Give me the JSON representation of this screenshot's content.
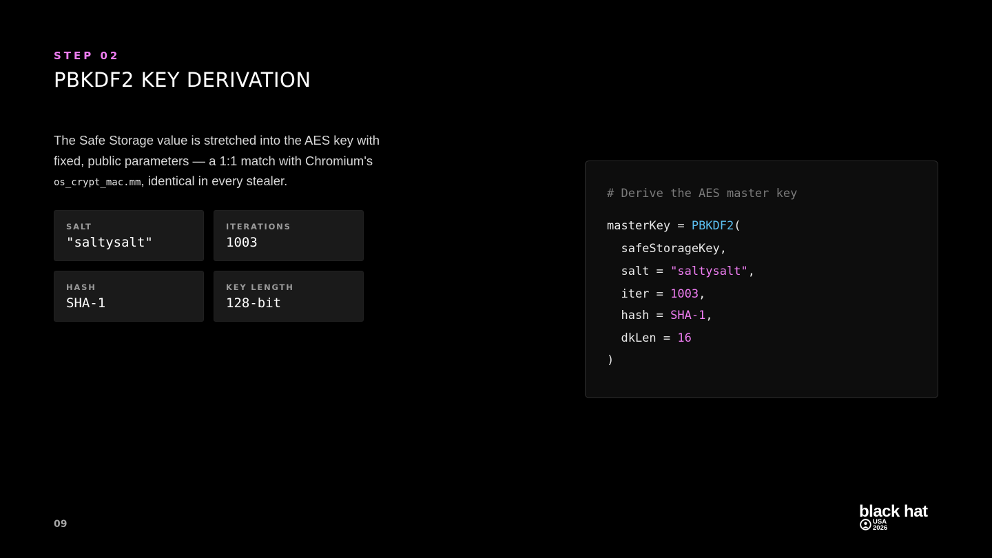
{
  "slide": {
    "eyebrow": "STEP 02",
    "title": "PBKDF2 KEY DERIVATION",
    "description": {
      "part1": "The Safe Storage value is stretched into the AES key with fixed, public parameters — a 1:1 match with Chromium's ",
      "code": "os_crypt_mac.mm",
      "part2": ", identical in every stealer."
    },
    "page_number": "09"
  },
  "params": [
    {
      "label": "SALT",
      "value": "\"saltysalt\""
    },
    {
      "label": "ITERATIONS",
      "value": "1003"
    },
    {
      "label": "HASH",
      "value": "SHA-1"
    },
    {
      "label": "KEY LENGTH",
      "value": "128-bit"
    }
  ],
  "code": {
    "comment": "# Derive the AES master key",
    "line1_var": "masterKey = ",
    "line1_func": "PBKDF2",
    "line1_paren": "(",
    "line2": "  safeStorageKey,",
    "line3_key": "  salt = ",
    "line3_val": "\"saltysalt\"",
    "line3_end": ",",
    "line4_key": "  iter = ",
    "line4_val": "1003",
    "line4_end": ",",
    "line5_key": "  hash = ",
    "line5_val": "SHA-1",
    "line5_end": ",",
    "line6_key": "  dkLen = ",
    "line6_val": "16",
    "line7": ")"
  },
  "logo": {
    "wordmark": "black hat",
    "line1": "USA",
    "line2": "2026"
  },
  "colors": {
    "background": "#000000",
    "accent_pink": "#f07ef3",
    "accent_blue": "#5cc0f2",
    "card": "#1a1a1a",
    "comment": "#7a7a7a"
  }
}
